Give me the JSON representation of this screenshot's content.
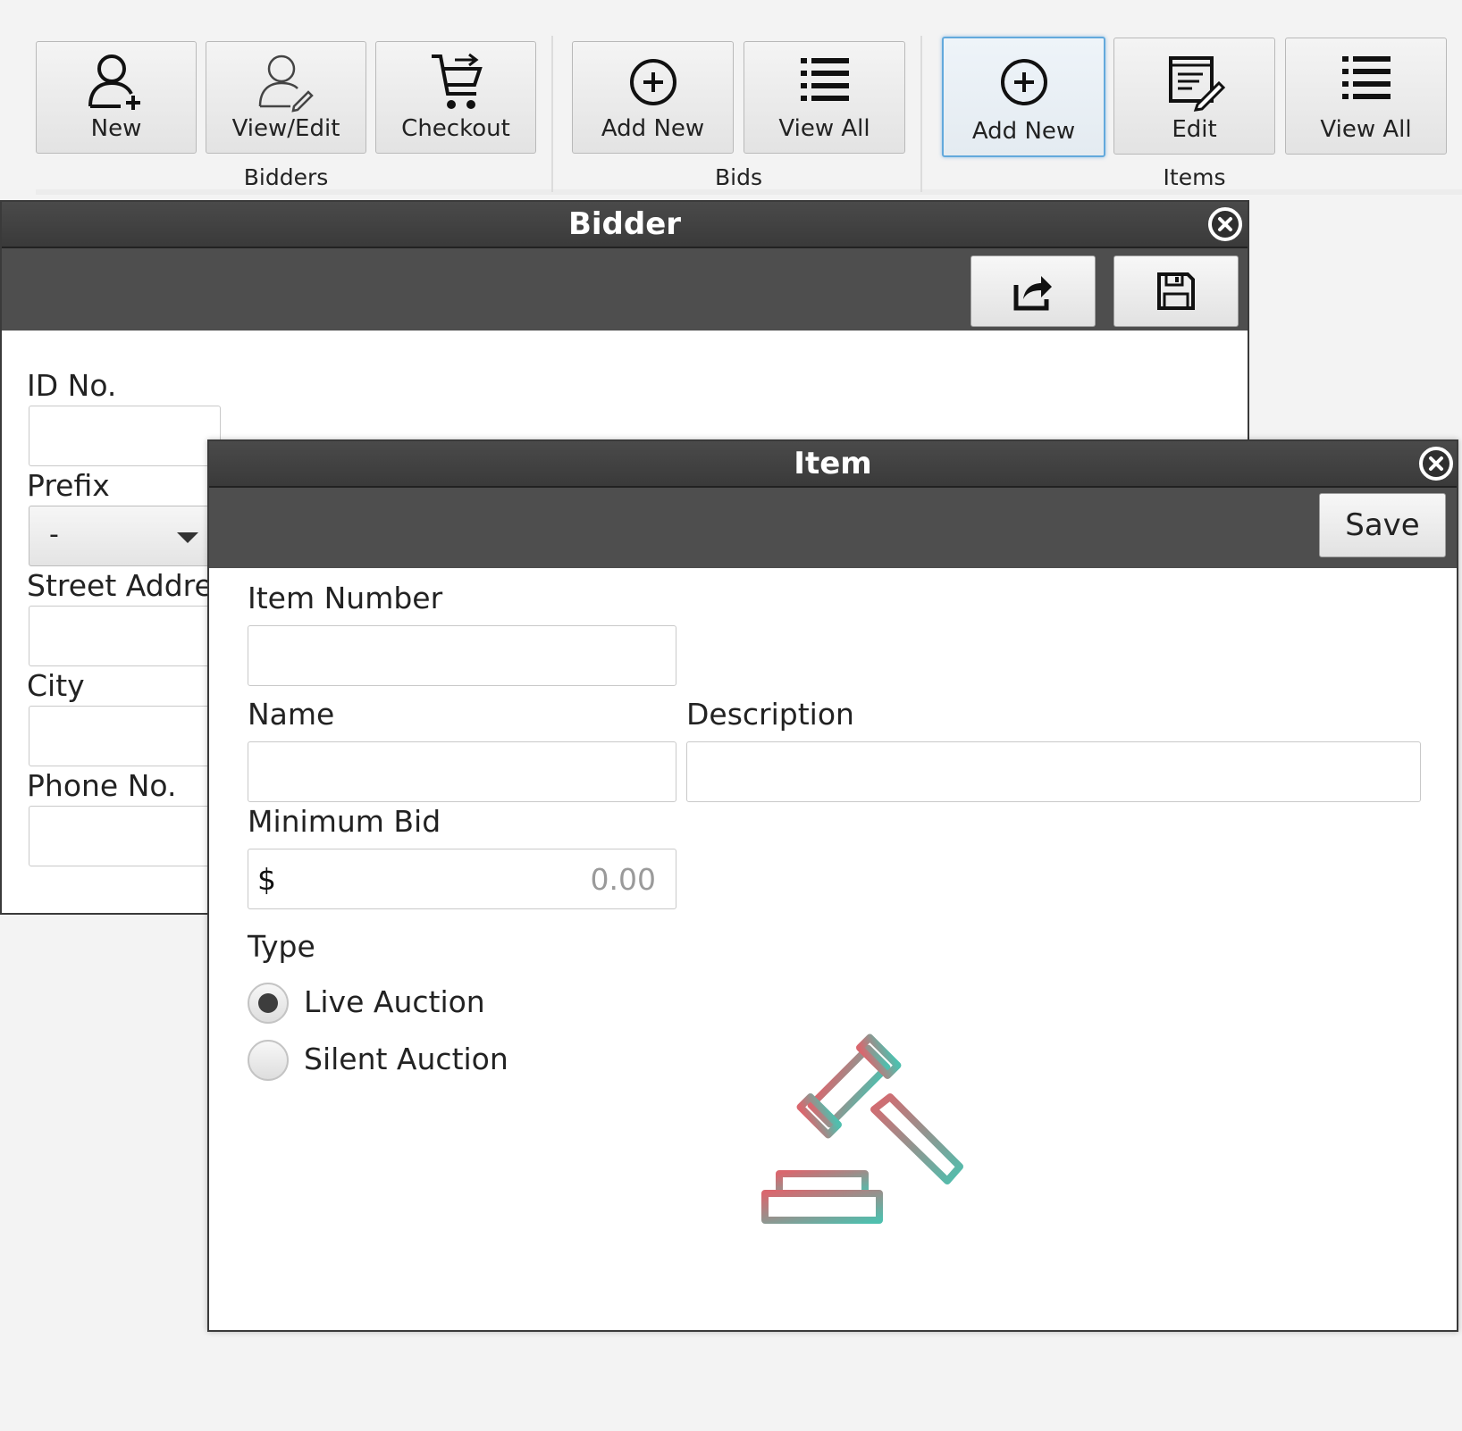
{
  "ribbon": {
    "groups": [
      {
        "label": "Bidders",
        "buttons": [
          {
            "label": "New",
            "icon": "user-add-icon"
          },
          {
            "label": "View/Edit",
            "icon": "user-edit-icon"
          },
          {
            "label": "Checkout",
            "icon": "cart-icon"
          }
        ]
      },
      {
        "label": "Bids",
        "buttons": [
          {
            "label": "Add New",
            "icon": "plus-circle-icon"
          },
          {
            "label": "View All",
            "icon": "list-icon"
          }
        ]
      },
      {
        "label": "Items",
        "buttons": [
          {
            "label": "Add New",
            "icon": "plus-circle-icon",
            "active": true
          },
          {
            "label": "Edit",
            "icon": "edit-document-icon"
          },
          {
            "label": "View All",
            "icon": "list-icon"
          }
        ]
      }
    ]
  },
  "bidder_window": {
    "title": "Bidder",
    "toolbar_icons": [
      "share-icon",
      "save-icon"
    ],
    "fields": {
      "id_label": "ID No.",
      "prefix_label": "Prefix",
      "prefix_value": "-",
      "street_label": "Street Addre",
      "city_label": "City",
      "phone_label": "Phone No."
    }
  },
  "item_window": {
    "title": "Item",
    "save_label": "Save",
    "fields": {
      "item_number_label": "Item Number",
      "name_label": "Name",
      "description_label": "Description",
      "min_bid_label": "Minimum Bid",
      "currency_symbol": "$",
      "min_bid_placeholder": "0.00",
      "type_label": "Type"
    },
    "type_options": [
      {
        "label": "Live Auction",
        "selected": true
      },
      {
        "label": "Silent Auction",
        "selected": false
      }
    ],
    "illustration": "gavel-icon"
  },
  "colors": {
    "accent": "#63a9dc",
    "titlebar": "#3a3a3a",
    "toolbar": "#4e4e4e",
    "gavel_start": "#d9676e",
    "gavel_end": "#4fbfae"
  }
}
